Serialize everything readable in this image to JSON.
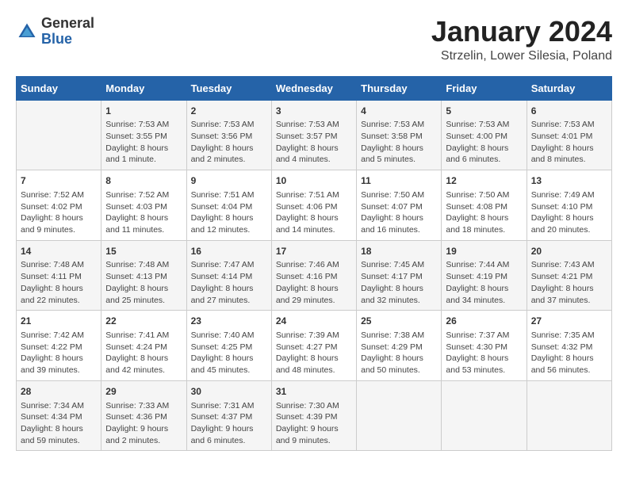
{
  "header": {
    "logo_general": "General",
    "logo_blue": "Blue",
    "title": "January 2024",
    "subtitle": "Strzelin, Lower Silesia, Poland"
  },
  "days_of_week": [
    "Sunday",
    "Monday",
    "Tuesday",
    "Wednesday",
    "Thursday",
    "Friday",
    "Saturday"
  ],
  "weeks": [
    [
      {
        "day": "",
        "content": ""
      },
      {
        "day": "1",
        "content": "Sunrise: 7:53 AM\nSunset: 3:55 PM\nDaylight: 8 hours\nand 1 minute."
      },
      {
        "day": "2",
        "content": "Sunrise: 7:53 AM\nSunset: 3:56 PM\nDaylight: 8 hours\nand 2 minutes."
      },
      {
        "day": "3",
        "content": "Sunrise: 7:53 AM\nSunset: 3:57 PM\nDaylight: 8 hours\nand 4 minutes."
      },
      {
        "day": "4",
        "content": "Sunrise: 7:53 AM\nSunset: 3:58 PM\nDaylight: 8 hours\nand 5 minutes."
      },
      {
        "day": "5",
        "content": "Sunrise: 7:53 AM\nSunset: 4:00 PM\nDaylight: 8 hours\nand 6 minutes."
      },
      {
        "day": "6",
        "content": "Sunrise: 7:53 AM\nSunset: 4:01 PM\nDaylight: 8 hours\nand 8 minutes."
      }
    ],
    [
      {
        "day": "7",
        "content": "Sunrise: 7:52 AM\nSunset: 4:02 PM\nDaylight: 8 hours\nand 9 minutes."
      },
      {
        "day": "8",
        "content": "Sunrise: 7:52 AM\nSunset: 4:03 PM\nDaylight: 8 hours\nand 11 minutes."
      },
      {
        "day": "9",
        "content": "Sunrise: 7:51 AM\nSunset: 4:04 PM\nDaylight: 8 hours\nand 12 minutes."
      },
      {
        "day": "10",
        "content": "Sunrise: 7:51 AM\nSunset: 4:06 PM\nDaylight: 8 hours\nand 14 minutes."
      },
      {
        "day": "11",
        "content": "Sunrise: 7:50 AM\nSunset: 4:07 PM\nDaylight: 8 hours\nand 16 minutes."
      },
      {
        "day": "12",
        "content": "Sunrise: 7:50 AM\nSunset: 4:08 PM\nDaylight: 8 hours\nand 18 minutes."
      },
      {
        "day": "13",
        "content": "Sunrise: 7:49 AM\nSunset: 4:10 PM\nDaylight: 8 hours\nand 20 minutes."
      }
    ],
    [
      {
        "day": "14",
        "content": "Sunrise: 7:48 AM\nSunset: 4:11 PM\nDaylight: 8 hours\nand 22 minutes."
      },
      {
        "day": "15",
        "content": "Sunrise: 7:48 AM\nSunset: 4:13 PM\nDaylight: 8 hours\nand 25 minutes."
      },
      {
        "day": "16",
        "content": "Sunrise: 7:47 AM\nSunset: 4:14 PM\nDaylight: 8 hours\nand 27 minutes."
      },
      {
        "day": "17",
        "content": "Sunrise: 7:46 AM\nSunset: 4:16 PM\nDaylight: 8 hours\nand 29 minutes."
      },
      {
        "day": "18",
        "content": "Sunrise: 7:45 AM\nSunset: 4:17 PM\nDaylight: 8 hours\nand 32 minutes."
      },
      {
        "day": "19",
        "content": "Sunrise: 7:44 AM\nSunset: 4:19 PM\nDaylight: 8 hours\nand 34 minutes."
      },
      {
        "day": "20",
        "content": "Sunrise: 7:43 AM\nSunset: 4:21 PM\nDaylight: 8 hours\nand 37 minutes."
      }
    ],
    [
      {
        "day": "21",
        "content": "Sunrise: 7:42 AM\nSunset: 4:22 PM\nDaylight: 8 hours\nand 39 minutes."
      },
      {
        "day": "22",
        "content": "Sunrise: 7:41 AM\nSunset: 4:24 PM\nDaylight: 8 hours\nand 42 minutes."
      },
      {
        "day": "23",
        "content": "Sunrise: 7:40 AM\nSunset: 4:25 PM\nDaylight: 8 hours\nand 45 minutes."
      },
      {
        "day": "24",
        "content": "Sunrise: 7:39 AM\nSunset: 4:27 PM\nDaylight: 8 hours\nand 48 minutes."
      },
      {
        "day": "25",
        "content": "Sunrise: 7:38 AM\nSunset: 4:29 PM\nDaylight: 8 hours\nand 50 minutes."
      },
      {
        "day": "26",
        "content": "Sunrise: 7:37 AM\nSunset: 4:30 PM\nDaylight: 8 hours\nand 53 minutes."
      },
      {
        "day": "27",
        "content": "Sunrise: 7:35 AM\nSunset: 4:32 PM\nDaylight: 8 hours\nand 56 minutes."
      }
    ],
    [
      {
        "day": "28",
        "content": "Sunrise: 7:34 AM\nSunset: 4:34 PM\nDaylight: 8 hours\nand 59 minutes."
      },
      {
        "day": "29",
        "content": "Sunrise: 7:33 AM\nSunset: 4:36 PM\nDaylight: 9 hours\nand 2 minutes."
      },
      {
        "day": "30",
        "content": "Sunrise: 7:31 AM\nSunset: 4:37 PM\nDaylight: 9 hours\nand 6 minutes."
      },
      {
        "day": "31",
        "content": "Sunrise: 7:30 AM\nSunset: 4:39 PM\nDaylight: 9 hours\nand 9 minutes."
      },
      {
        "day": "",
        "content": ""
      },
      {
        "day": "",
        "content": ""
      },
      {
        "day": "",
        "content": ""
      }
    ]
  ]
}
